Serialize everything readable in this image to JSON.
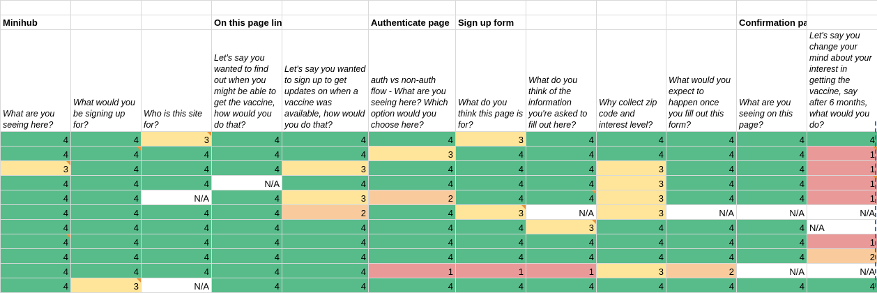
{
  "sections": [
    "Minihub",
    "",
    "",
    "On this page links",
    "",
    "Authenticate page",
    "Sign up form",
    "",
    "",
    "",
    "Confirmation page",
    ""
  ],
  "questions": [
    "What are you seeing here?",
    "What would you be signing up for?",
    "Who is this site for?",
    "Let's say you wanted to find out when you might be able to get the vaccine, how would you do that?",
    "Let's say you wanted to sign up to get updates on when a vaccine was available, how would you do that?",
    "auth vs non-auth flow -  What are you seeing here? Which option would you choose here?",
    "What do you think this page is for?",
    "What do you think of the information you're asked to fill out here?",
    "Why collect zip code and interest level?",
    "What would you expect to happen once you fill out this form?",
    "What are you seeing on this page?",
    "Let's say you change your mind about your interest in getting the vaccine, say after 6 months, what would you do?"
  ],
  "rows": [
    [
      {
        "v": "4",
        "c": "green"
      },
      {
        "v": "4",
        "c": "green"
      },
      {
        "v": "3",
        "c": "yellow",
        "n": true
      },
      {
        "v": "4",
        "c": "green"
      },
      {
        "v": "4",
        "c": "green"
      },
      {
        "v": "4",
        "c": "green"
      },
      {
        "v": "3",
        "c": "yellow"
      },
      {
        "v": "4",
        "c": "green"
      },
      {
        "v": "4",
        "c": "green"
      },
      {
        "v": "4",
        "c": "green"
      },
      {
        "v": "4",
        "c": "green"
      },
      {
        "v": "4",
        "c": "green"
      }
    ],
    [
      {
        "v": "4",
        "c": "green"
      },
      {
        "v": "4",
        "c": "green",
        "n": true
      },
      {
        "v": "4",
        "c": "green"
      },
      {
        "v": "4",
        "c": "green"
      },
      {
        "v": "4",
        "c": "green"
      },
      {
        "v": "3",
        "c": "yellow"
      },
      {
        "v": "4",
        "c": "green"
      },
      {
        "v": "4",
        "c": "green"
      },
      {
        "v": "4",
        "c": "green"
      },
      {
        "v": "4",
        "c": "green"
      },
      {
        "v": "4",
        "c": "green"
      },
      {
        "v": "1",
        "c": "red",
        "n": true
      }
    ],
    [
      {
        "v": "3",
        "c": "yellow",
        "n": true
      },
      {
        "v": "4",
        "c": "green"
      },
      {
        "v": "4",
        "c": "green"
      },
      {
        "v": "4",
        "c": "green"
      },
      {
        "v": "3",
        "c": "yellow"
      },
      {
        "v": "4",
        "c": "green"
      },
      {
        "v": "4",
        "c": "green"
      },
      {
        "v": "4",
        "c": "green"
      },
      {
        "v": "3",
        "c": "yellow"
      },
      {
        "v": "4",
        "c": "green"
      },
      {
        "v": "4",
        "c": "green"
      },
      {
        "v": "1",
        "c": "red"
      }
    ],
    [
      {
        "v": "4",
        "c": "green"
      },
      {
        "v": "4",
        "c": "green"
      },
      {
        "v": "4",
        "c": "green"
      },
      {
        "v": "N/A",
        "c": "white"
      },
      {
        "v": "4",
        "c": "green"
      },
      {
        "v": "4",
        "c": "green"
      },
      {
        "v": "4",
        "c": "green"
      },
      {
        "v": "4",
        "c": "green"
      },
      {
        "v": "3",
        "c": "yellow"
      },
      {
        "v": "4",
        "c": "green"
      },
      {
        "v": "4",
        "c": "green"
      },
      {
        "v": "1",
        "c": "red",
        "n": true
      }
    ],
    [
      {
        "v": "4",
        "c": "green"
      },
      {
        "v": "4",
        "c": "green"
      },
      {
        "v": "N/A",
        "c": "white"
      },
      {
        "v": "4",
        "c": "green"
      },
      {
        "v": "3",
        "c": "yellow"
      },
      {
        "v": "2",
        "c": "orange"
      },
      {
        "v": "4",
        "c": "green"
      },
      {
        "v": "4",
        "c": "green",
        "n": true
      },
      {
        "v": "3",
        "c": "yellow"
      },
      {
        "v": "4",
        "c": "green"
      },
      {
        "v": "4",
        "c": "green"
      },
      {
        "v": "1",
        "c": "red"
      }
    ],
    [
      {
        "v": "4",
        "c": "green"
      },
      {
        "v": "4",
        "c": "green"
      },
      {
        "v": "4",
        "c": "green"
      },
      {
        "v": "4",
        "c": "green"
      },
      {
        "v": "2",
        "c": "orange"
      },
      {
        "v": "4",
        "c": "green"
      },
      {
        "v": "3",
        "c": "yellow",
        "n": true
      },
      {
        "v": "N/A",
        "c": "white"
      },
      {
        "v": "3",
        "c": "yellow"
      },
      {
        "v": "N/A",
        "c": "white"
      },
      {
        "v": "N/A",
        "c": "white"
      },
      {
        "v": "N/A",
        "c": "white"
      }
    ],
    [
      {
        "v": "4",
        "c": "green"
      },
      {
        "v": "4",
        "c": "green"
      },
      {
        "v": "4",
        "c": "green"
      },
      {
        "v": "4",
        "c": "green"
      },
      {
        "v": "4",
        "c": "green"
      },
      {
        "v": "4",
        "c": "green"
      },
      {
        "v": "4",
        "c": "green"
      },
      {
        "v": "3",
        "c": "yellow",
        "n": true
      },
      {
        "v": "4",
        "c": "green"
      },
      {
        "v": "4",
        "c": "green"
      },
      {
        "v": "4",
        "c": "green"
      },
      {
        "v": "N/A",
        "c": "white",
        "left": true
      }
    ],
    [
      {
        "v": "4",
        "c": "green",
        "n": true
      },
      {
        "v": "4",
        "c": "green"
      },
      {
        "v": "4",
        "c": "green"
      },
      {
        "v": "4",
        "c": "green"
      },
      {
        "v": "4",
        "c": "green"
      },
      {
        "v": "4",
        "c": "green"
      },
      {
        "v": "4",
        "c": "green"
      },
      {
        "v": "4",
        "c": "green"
      },
      {
        "v": "4",
        "c": "green"
      },
      {
        "v": "4",
        "c": "green"
      },
      {
        "v": "4",
        "c": "green"
      },
      {
        "v": "1",
        "c": "red"
      }
    ],
    [
      {
        "v": "4",
        "c": "green"
      },
      {
        "v": "4",
        "c": "green"
      },
      {
        "v": "4",
        "c": "green"
      },
      {
        "v": "4",
        "c": "green"
      },
      {
        "v": "4",
        "c": "green"
      },
      {
        "v": "4",
        "c": "green"
      },
      {
        "v": "4",
        "c": "green"
      },
      {
        "v": "4",
        "c": "green"
      },
      {
        "v": "4",
        "c": "green"
      },
      {
        "v": "4",
        "c": "green"
      },
      {
        "v": "4",
        "c": "green"
      },
      {
        "v": "2",
        "c": "orange"
      }
    ],
    [
      {
        "v": "4",
        "c": "green"
      },
      {
        "v": "4",
        "c": "green"
      },
      {
        "v": "4",
        "c": "green"
      },
      {
        "v": "4",
        "c": "green"
      },
      {
        "v": "4",
        "c": "green"
      },
      {
        "v": "1",
        "c": "red"
      },
      {
        "v": "1",
        "c": "red"
      },
      {
        "v": "1",
        "c": "red"
      },
      {
        "v": "3",
        "c": "yellow"
      },
      {
        "v": "2",
        "c": "orange"
      },
      {
        "v": "N/A",
        "c": "white"
      },
      {
        "v": "N/A",
        "c": "white"
      }
    ],
    [
      {
        "v": "4",
        "c": "green"
      },
      {
        "v": "3",
        "c": "yellow",
        "n": true
      },
      {
        "v": "N/A",
        "c": "white"
      },
      {
        "v": "4",
        "c": "green"
      },
      {
        "v": "4",
        "c": "green"
      },
      {
        "v": "4",
        "c": "green"
      },
      {
        "v": "4",
        "c": "green"
      },
      {
        "v": "4",
        "c": "green"
      },
      {
        "v": "4",
        "c": "green"
      },
      {
        "v": "4",
        "c": "green"
      },
      {
        "v": "4",
        "c": "green"
      },
      {
        "v": "4",
        "c": "green"
      }
    ]
  ],
  "colors": {
    "green": "#57bb8a",
    "yellow": "#ffe599",
    "orange": "#f9cb9c",
    "red": "#ea9999",
    "white": "#ffffff"
  }
}
